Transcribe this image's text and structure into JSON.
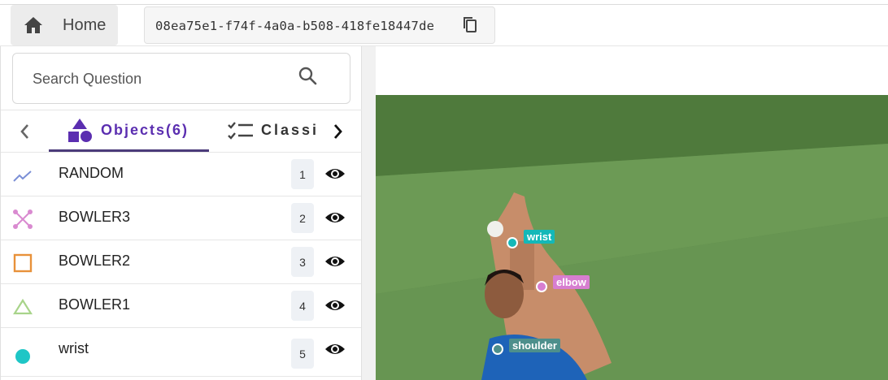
{
  "topbar": {
    "home_label": "Home",
    "task_id": "08ea75e1-f74f-4a0a-b508-418fe18447de"
  },
  "search": {
    "placeholder": "Search Question"
  },
  "tabs": {
    "objects_label": "Objects(6)",
    "classifications_label": "Classi"
  },
  "objects": [
    {
      "name": "RANDOM",
      "index": "1",
      "icon": "polyline-icon",
      "color": "#7b8fd6"
    },
    {
      "name": "BOWLER3",
      "index": "2",
      "icon": "skeleton-icon",
      "color": "#d98ad0"
    },
    {
      "name": "BOWLER2",
      "index": "3",
      "icon": "square-icon",
      "color": "#e8913a"
    },
    {
      "name": "BOWLER1",
      "index": "4",
      "icon": "triangle-icon",
      "color": "#a8d48a"
    },
    {
      "name": "wrist",
      "index": "5",
      "icon": "point-icon",
      "color": "#1ec6c6"
    }
  ],
  "canvas": {
    "keypoints": [
      {
        "label": "wrist",
        "color": "#14b8b8"
      },
      {
        "label": "elbow",
        "color": "#d77ed0"
      },
      {
        "label": "shoulder",
        "color": "#4d8f8c"
      }
    ]
  }
}
